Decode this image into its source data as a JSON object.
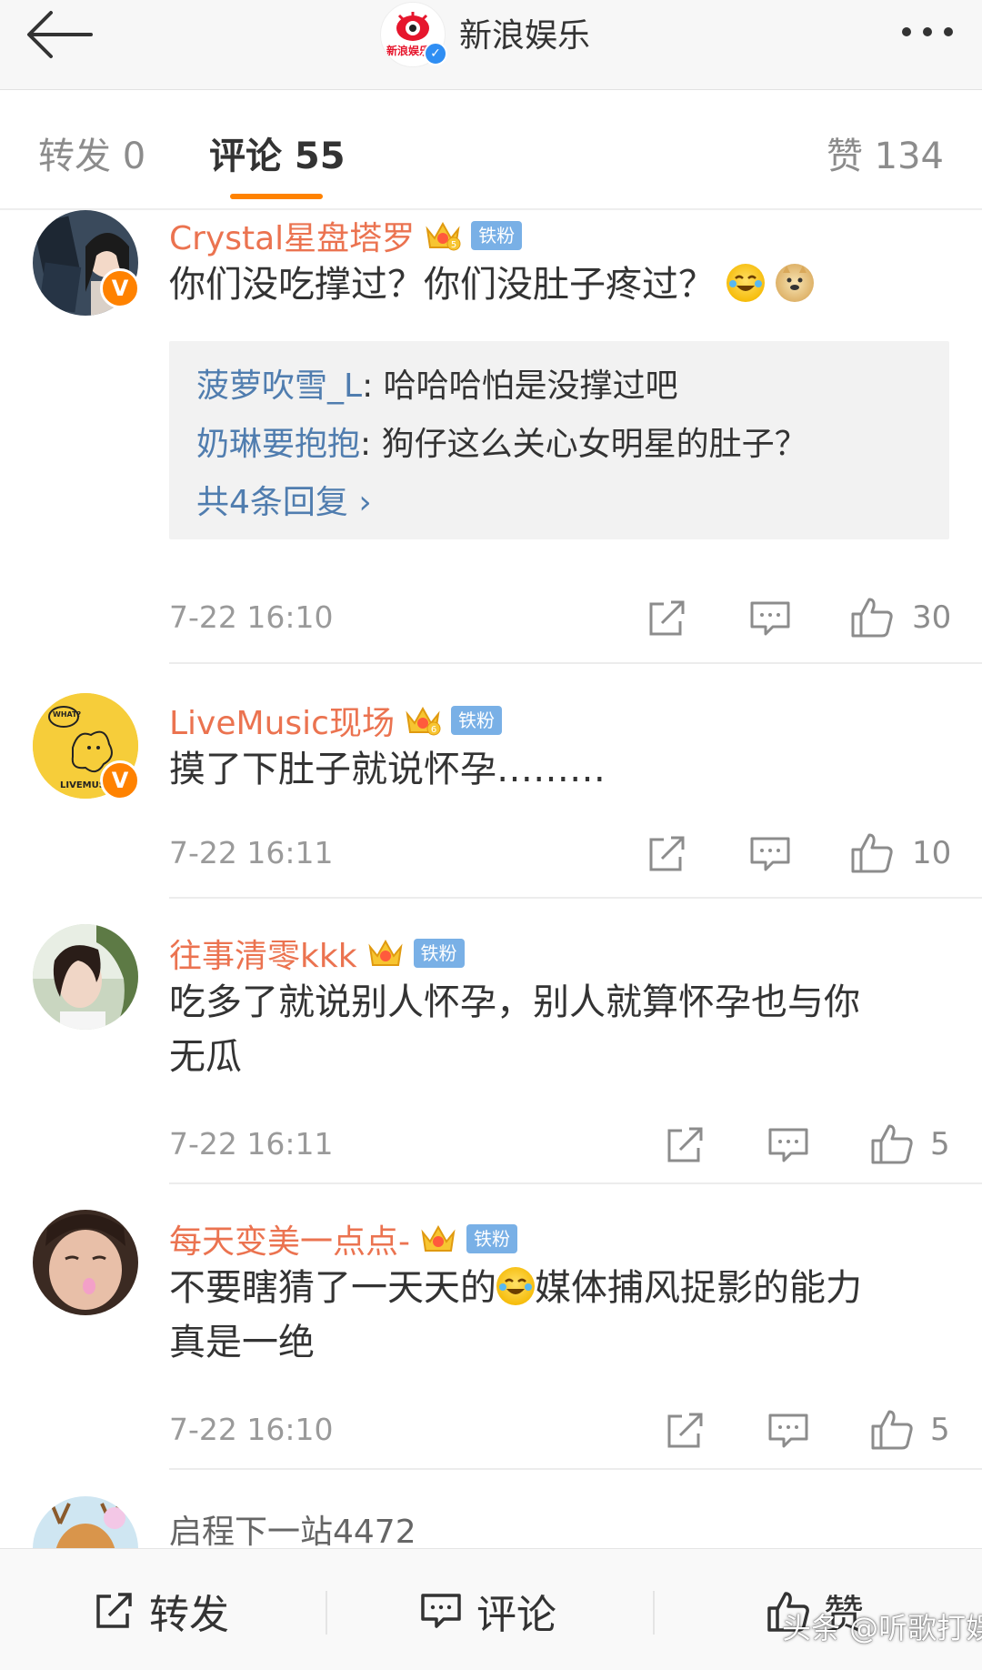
{
  "header": {
    "title": "新浪娱乐",
    "avatar_text": "新浪娱乐",
    "verified_mark": "✓"
  },
  "tabs": {
    "forward": "转发 0",
    "comment": "评论 55",
    "like": "赞 134"
  },
  "colors": {
    "accent": "#ff8200",
    "username": "#eb7350",
    "link": "#507daf",
    "fan_badge": "#79b0e6"
  },
  "comments": [
    {
      "username": "Crystal星盘塔罗",
      "fan_badge": "铁粉",
      "verified": "V",
      "crown_level": "5",
      "text": "你们没吃撑过？你们没肚子疼过？",
      "replies": [
        {
          "user": "菠萝吹雪_L",
          "text": ": 哈哈哈怕是没撑过吧"
        },
        {
          "user": "奶琳要抱抱",
          "text": ": 狗仔这么关心女明星的肚子？"
        }
      ],
      "more_replies": "共4条回复 ›",
      "time": "7-22 16:10",
      "likes": "30"
    },
    {
      "username": "LiveMusic现场",
      "fan_badge": "铁粉",
      "verified": "V",
      "crown_level": "6",
      "avatar_text_top": "WHAT?",
      "avatar_text_bottom": "LIVEMUS",
      "text": "摸了下肚子就说怀孕………",
      "time": "7-22 16:11",
      "likes": "10"
    },
    {
      "username": "往事清零kkk",
      "fan_badge": "铁粉",
      "text_line1": "吃多了就说别人怀孕，别人就算怀孕也与你",
      "text_line2": "无瓜",
      "time": "7-22 16:11",
      "likes": "5"
    },
    {
      "username": "每天变美一点点-",
      "fan_badge": "铁粉",
      "text_part1": "不要瞎猜了一天天的",
      "text_part2": "媒体捕风捉影的能力",
      "text_line2": "真是一绝",
      "time": "7-22 16:10",
      "likes": "5"
    },
    {
      "username": "启程下一站4472"
    }
  ],
  "bottom_bar": {
    "forward": "转发",
    "comment": "评论",
    "like": "赞"
  },
  "watermark": "头条 @听歌打娱",
  "icons": {
    "back": "back-arrow-icon",
    "more": "more-dots-icon",
    "share": "share-icon",
    "comment": "comment-icon",
    "like": "thumbs-up-icon"
  }
}
